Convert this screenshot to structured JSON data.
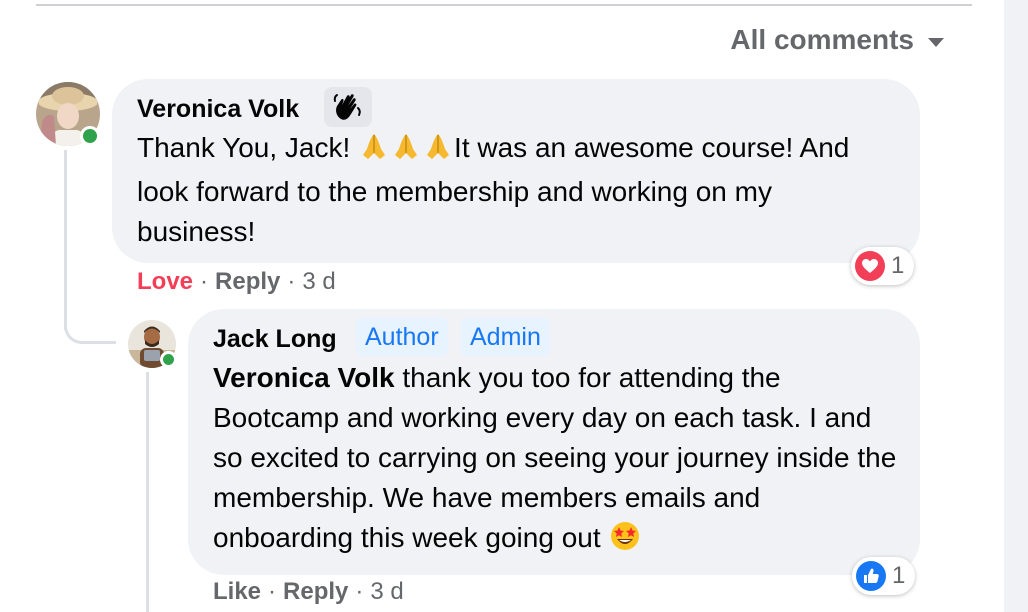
{
  "sort_menu": {
    "label": "All comments",
    "icon": "caret-down-icon"
  },
  "comments": [
    {
      "author": "Veronica Volk",
      "badge_icon": "waving-hand-icon",
      "text_parts": [
        "Thank You, Jack! ",
        "It was an awesome course! And look forward to the membership and working on my business!"
      ],
      "inline_emoji": [
        "folded-hands-emoji",
        "folded-hands-emoji",
        "folded-hands-emoji"
      ],
      "my_reaction": "Love",
      "reply_label": "Reply",
      "time": "3 d",
      "reaction_icon": "love-icon",
      "reaction_count": "1",
      "online": true
    }
  ],
  "reply": {
    "author": "Jack Long",
    "tags": [
      "Author",
      "Admin"
    ],
    "mention": "Veronica Volk",
    "text": " thank you too for attending the Bootcamp and working every day on each task. I and so excited to carrying on seeing your journey inside the membership. We have members emails and onboarding this week going out ",
    "end_emoji": "star-struck-emoji",
    "like_label": "Like",
    "reply_label": "Reply",
    "time": "3 d",
    "reaction_icon": "like-icon",
    "reaction_count": "1",
    "online": true
  },
  "colors": {
    "love_red": "#f33e58",
    "like_blue": "#1877f2",
    "online_green": "#31a24c",
    "bubble_bg": "#f0f2f5"
  }
}
